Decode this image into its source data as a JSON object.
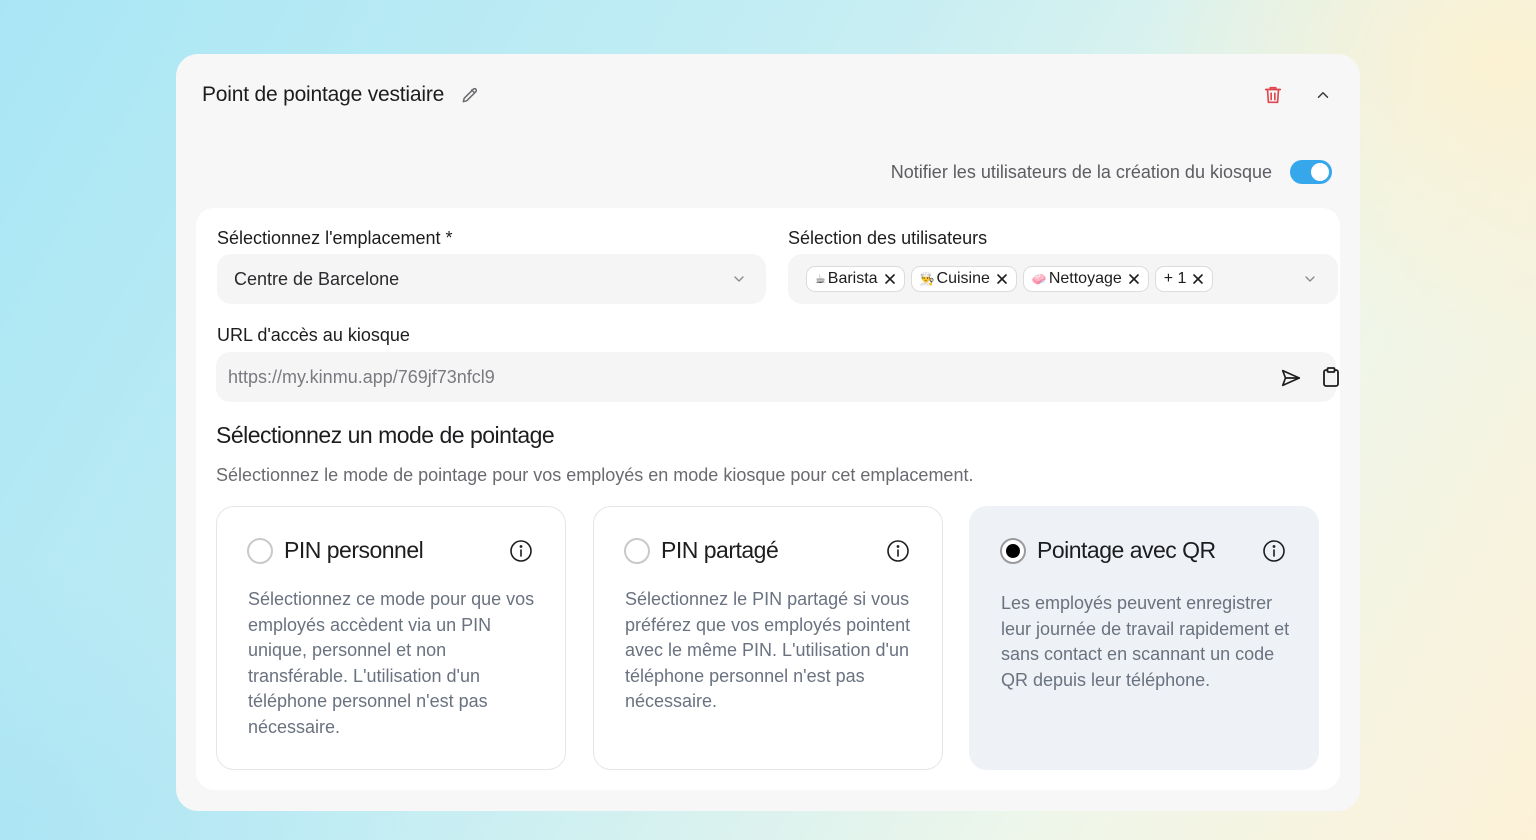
{
  "header": {
    "title": "Point de pointage vestiaire"
  },
  "notify": {
    "label": "Notifier les utilisateurs de la création du kiosque",
    "enabled": true
  },
  "location": {
    "label": "Sélectionnez l'emplacement *",
    "value": "Centre de Barcelone"
  },
  "users": {
    "label": "Sélection des utilisateurs",
    "tags": [
      {
        "emoji": "☕",
        "label": "Barista"
      },
      {
        "emoji": "👨‍🍳",
        "label": "Cuisine"
      },
      {
        "emoji": "🧼",
        "label": "Nettoyage"
      },
      {
        "emoji": "",
        "label": "+ 1"
      }
    ]
  },
  "kiosk_url": {
    "label": "URL d'accès au kiosque",
    "value": "https://my.kinmu.app/769jf73nfcl9"
  },
  "mode_section": {
    "title": "Sélectionnez un mode de pointage",
    "description": "Sélectionnez le mode de pointage pour vos employés en mode kiosque pour cet emplacement.",
    "modes": [
      {
        "title": "PIN personnel",
        "description": "Sélectionnez ce mode pour que vos employés accèdent via un PIN unique, personnel et non transférable. L'utilisation d'un téléphone personnel n'est pas nécessaire.",
        "selected": false
      },
      {
        "title": "PIN partagé",
        "description": "Sélectionnez le PIN partagé si vous préférez que vos employés pointent avec le même PIN. L'utilisation d'un téléphone personnel n'est pas nécessaire.",
        "selected": false
      },
      {
        "title": "Pointage avec QR",
        "description": "Les employés peuvent enregistrer leur journée de travail rapidement et sans contact en scannant un code QR depuis leur téléphone.",
        "selected": true
      }
    ]
  },
  "colors": {
    "accent": "#37a7ec",
    "danger": "#e0474c",
    "selected_card": "#eef2f6"
  },
  "icons": {
    "edit": "pencil-icon",
    "delete": "trash-icon",
    "collapse": "chevron-up-icon",
    "dropdown": "chevron-down-icon",
    "send": "send-icon",
    "copy": "clipboard-icon",
    "info": "info-icon",
    "remove_tag": "close-icon"
  }
}
